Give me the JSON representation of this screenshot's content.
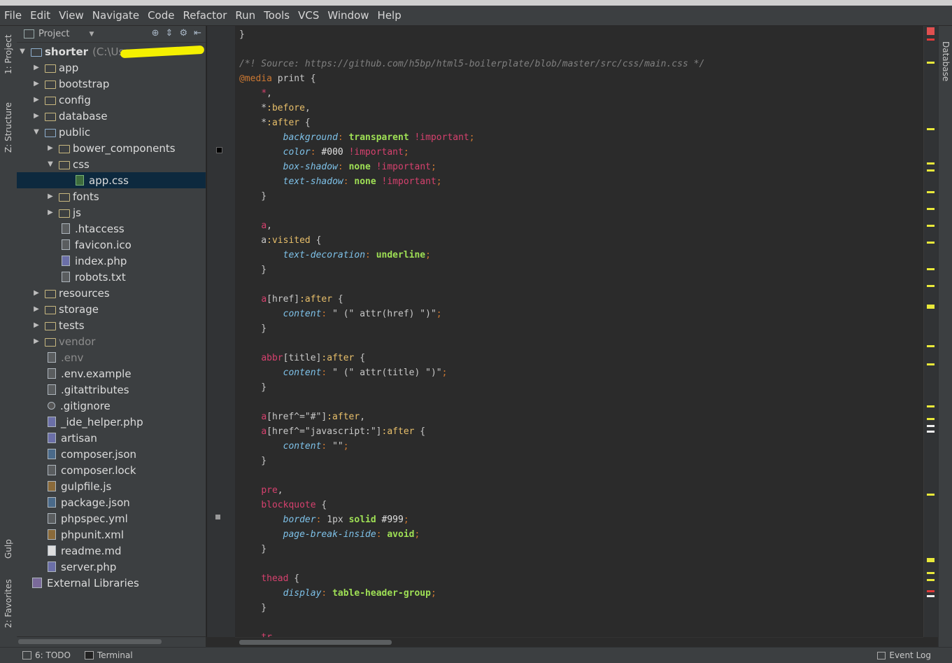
{
  "menu": [
    "File",
    "Edit",
    "View",
    "Navigate",
    "Code",
    "Refactor",
    "Run",
    "Tools",
    "VCS",
    "Window",
    "Help"
  ],
  "left_tabs": {
    "project": "1: Project",
    "structure": "Z: Structure",
    "gulp": "Gulp",
    "favorites": "2: Favorites"
  },
  "right_tabs": {
    "database": "Database"
  },
  "project_panel": {
    "title": "Project"
  },
  "tree": {
    "root": {
      "name": "shorter",
      "path": "(C:\\User"
    },
    "items": [
      {
        "label": "app"
      },
      {
        "label": "bootstrap"
      },
      {
        "label": "config"
      },
      {
        "label": "database"
      },
      {
        "label": "public"
      },
      {
        "label": "bower_components"
      },
      {
        "label": "css"
      },
      {
        "label": "app.css"
      },
      {
        "label": "fonts"
      },
      {
        "label": "js"
      },
      {
        "label": ".htaccess"
      },
      {
        "label": "favicon.ico"
      },
      {
        "label": "index.php"
      },
      {
        "label": "robots.txt"
      },
      {
        "label": "resources"
      },
      {
        "label": "storage"
      },
      {
        "label": "tests"
      },
      {
        "label": "vendor"
      },
      {
        "label": ".env"
      },
      {
        "label": ".env.example"
      },
      {
        "label": ".gitattributes"
      },
      {
        "label": ".gitignore"
      },
      {
        "label": "_ide_helper.php"
      },
      {
        "label": "artisan"
      },
      {
        "label": "composer.json"
      },
      {
        "label": "composer.lock"
      },
      {
        "label": "gulpfile.js"
      },
      {
        "label": "package.json"
      },
      {
        "label": "phpspec.yml"
      },
      {
        "label": "phpunit.xml"
      },
      {
        "label": "readme.md"
      },
      {
        "label": "server.php"
      },
      {
        "label": "External Libraries"
      }
    ]
  },
  "code_lines": [
    "}",
    "",
    "/*! Source: https://github.com/h5bp/html5-boilerplate/blob/master/src/css/main.css */",
    "@media print {",
    "    *,",
    "    *:before,",
    "    *:after {",
    "        background: transparent !important;",
    "        color: #000 !important;",
    "        box-shadow: none !important;",
    "        text-shadow: none !important;",
    "    }",
    "",
    "    a,",
    "    a:visited {",
    "        text-decoration: underline;",
    "    }",
    "",
    "    a[href]:after {",
    "        content: \" (\" attr(href) \")\";",
    "    }",
    "",
    "    abbr[title]:after {",
    "        content: \" (\" attr(title) \")\";",
    "    }",
    "",
    "    a[href^=\"#\"]:after,",
    "    a[href^=\"javascript:\"]:after {",
    "        content: \"\";",
    "    }",
    "",
    "    pre,",
    "    blockquote {",
    "        border: 1px solid #999;",
    "        page-break-inside: avoid;",
    "    }",
    "",
    "    thead {",
    "        display: table-header-group;",
    "    }",
    "",
    "    tr,"
  ],
  "status": {
    "todo": "6: TODO",
    "terminal": "Terminal",
    "event_log": "Event Log"
  }
}
